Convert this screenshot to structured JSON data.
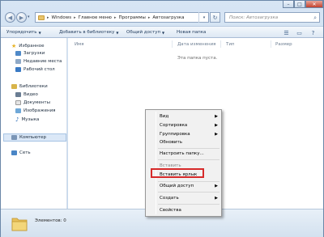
{
  "window": {
    "controls": {
      "minimize": "–",
      "maximize": "□",
      "close": "✕"
    }
  },
  "address": {
    "segments": [
      "Windows",
      "Главное меню",
      "Программы",
      "Автозагрузка"
    ],
    "search_placeholder": "Поиск: Автозагрузка"
  },
  "toolbar": {
    "organize": "Упорядочить",
    "add_to_library": "Добавить в библиотеку",
    "share": "Общий доступ",
    "new_folder": "Новая папка"
  },
  "sidebar": {
    "favorites": "Избранное",
    "downloads": "Загрузки",
    "recent": "Недавние места",
    "desktop": "Рабочий стол",
    "libraries": "Библиотеки",
    "video": "Видео",
    "documents": "Документы",
    "images": "Изображения",
    "music": "Музыка",
    "computer": "Компьютер",
    "network": "Сеть"
  },
  "columns": {
    "name": "Имя",
    "date": "Дата изменения",
    "type": "Тип",
    "size": "Размер"
  },
  "content": {
    "empty_message": "Эта папка пуста."
  },
  "status": {
    "items": "Элементов: 0"
  },
  "context_menu": {
    "view": "Вид",
    "sort": "Сортировка",
    "group": "Группировка",
    "refresh": "Обновить",
    "customize": "Настроить папку...",
    "paste": "Вставить",
    "paste_shortcut": "Вставить ярлык",
    "share": "Общий доступ",
    "create": "Создать",
    "properties": "Свойства",
    "highlight_color": "#d62a2a"
  }
}
